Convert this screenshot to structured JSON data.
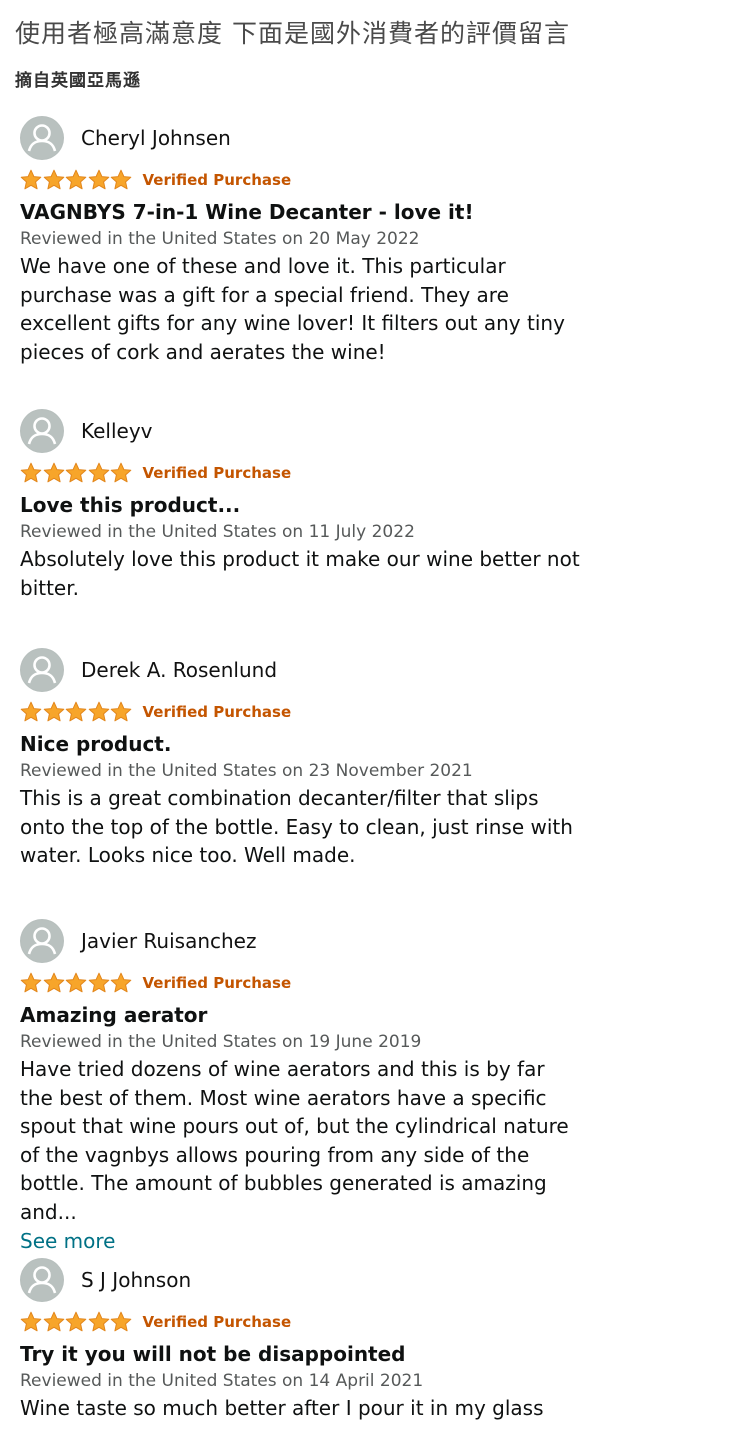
{
  "banner": {
    "title": "使用者極高滿意度  下面是國外消費者的評價留言",
    "subtitle": "摘自英國亞馬遜"
  },
  "colors": {
    "star": "#f7a52a",
    "star_stroke": "#e2861c",
    "verified": "#c45500",
    "link": "#007185"
  },
  "verified_label": "Verified Purchase",
  "reviews": [
    {
      "name": "Cheryl Johnsen",
      "rating": 5,
      "title": "VAGNBYS 7-in-1 Wine Decanter - love it!",
      "date": "Reviewed in the United States on 20 May 2022",
      "body": "We have one of these and love it. This particular purchase was a gift for a special friend. They are excellent gifts for any wine lover! It filters out any tiny pieces of cork and aerates the wine!"
    },
    {
      "name": "Kelleyv",
      "rating": 5,
      "title": "Love this product...",
      "date": "Reviewed in the United States on 11 July 2022",
      "body": "Absolutely love this product it make our wine better not bitter."
    },
    {
      "name": "Derek A. Rosenlund",
      "rating": 5,
      "title": "Nice product.",
      "date": "Reviewed in the United States on 23 November 2021",
      "body": "This is a great combination decanter/filter that slips onto the top of the bottle. Easy to clean, just rinse with water. Looks nice too. Well made."
    },
    {
      "name": "Javier Ruisanchez",
      "rating": 5,
      "title": "Amazing aerator",
      "date": "Reviewed in the United States on 19 June 2019",
      "body": "Have tried dozens of wine aerators and this is by far the best of them. Most wine aerators have a specific spout that wine pours out of, but the cylindrical nature of the vagnbys allows pouring from any side of the bottle. The amount of bubbles generated is amazing and...",
      "see_more": "See more"
    },
    {
      "name": "S J Johnson",
      "rating": 5,
      "title": "Try it you will not be disappointed",
      "date": "Reviewed in the United States on 14 April 2021",
      "body": "Wine taste so much better after I pour it in my glass"
    }
  ]
}
